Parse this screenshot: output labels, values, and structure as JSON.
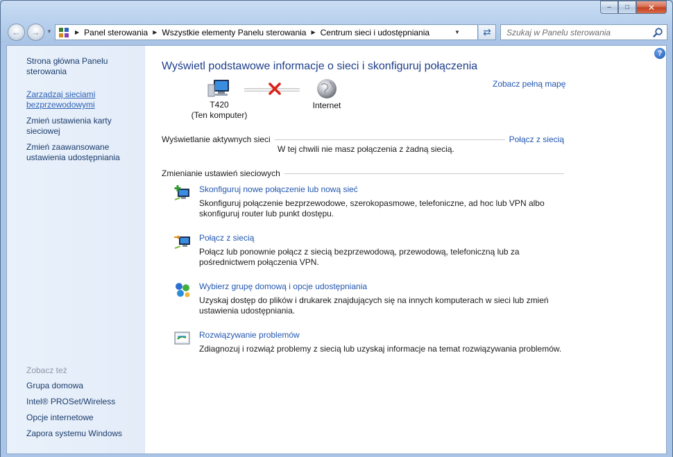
{
  "window": {
    "minimize_glyph": "‒",
    "maximize_glyph": "□",
    "close_glyph": "✕"
  },
  "toolbar": {
    "back_glyph": "←",
    "forward_glyph": "→",
    "breadcrumbs": [
      "Panel sterowania",
      "Wszystkie elementy Panelu sterowania",
      "Centrum sieci i udostępniania"
    ],
    "breadcrumb_separator": "▶",
    "dropdown_glyph": "▼",
    "refresh_glyph": "⇄",
    "search_placeholder": "Szukaj w Panelu sterowania"
  },
  "sidebar": {
    "home_link": "Strona główna Panelu sterowania",
    "links": [
      "Zarządzaj sieciami bezprzewodowymi",
      "Zmień ustawienia karty sieciowej",
      "Zmień zaawansowane ustawienia udostępniania"
    ],
    "see_also_title": "Zobacz też",
    "see_also": [
      "Grupa domowa",
      "Intel® PROSet/Wireless",
      "Opcje internetowe",
      "Zapora systemu Windows"
    ]
  },
  "main": {
    "help_glyph": "?",
    "title": "Wyświetl podstawowe informacje o sieci i skonfiguruj połączenia",
    "full_map_link": "Zobacz pełną mapę",
    "computer_name": "T420",
    "computer_sub": "(Ten komputer)",
    "internet_label": "Internet",
    "active_networks_label": "Wyświetlanie aktywnych sieci",
    "connect_link": "Połącz z siecią",
    "no_connection_msg": "W tej chwili nie masz połączenia z żadną siecią.",
    "change_settings_label": "Zmienianie ustawień sieciowych",
    "tasks": [
      {
        "title": "Skonfiguruj nowe połączenie lub nową sieć",
        "desc": "Skonfiguruj połączenie bezprzewodowe, szerokopasmowe, telefoniczne, ad hoc lub VPN albo skonfiguruj router lub punkt dostępu."
      },
      {
        "title": "Połącz z siecią",
        "desc": "Połącz lub ponownie połącz z siecią bezprzewodową, przewodową, telefoniczną lub za pośrednictwem połączenia VPN."
      },
      {
        "title": "Wybierz grupę domową i opcje udostępniania",
        "desc": "Uzyskaj dostęp do plików i drukarek znajdujących się na innych komputerach w sieci lub zmień ustawienia udostępniania."
      },
      {
        "title": "Rozwiązywanie problemów",
        "desc": "Zdiagnozuj i rozwiąż problemy z siecią lub uzyskaj informacje na temat rozwiązywania problemów."
      }
    ]
  },
  "colors": {
    "link": "#2256b0",
    "title": "#1d3e8a",
    "sidebar_bg": "#e5eef9",
    "frame": "#b9d1ee"
  }
}
